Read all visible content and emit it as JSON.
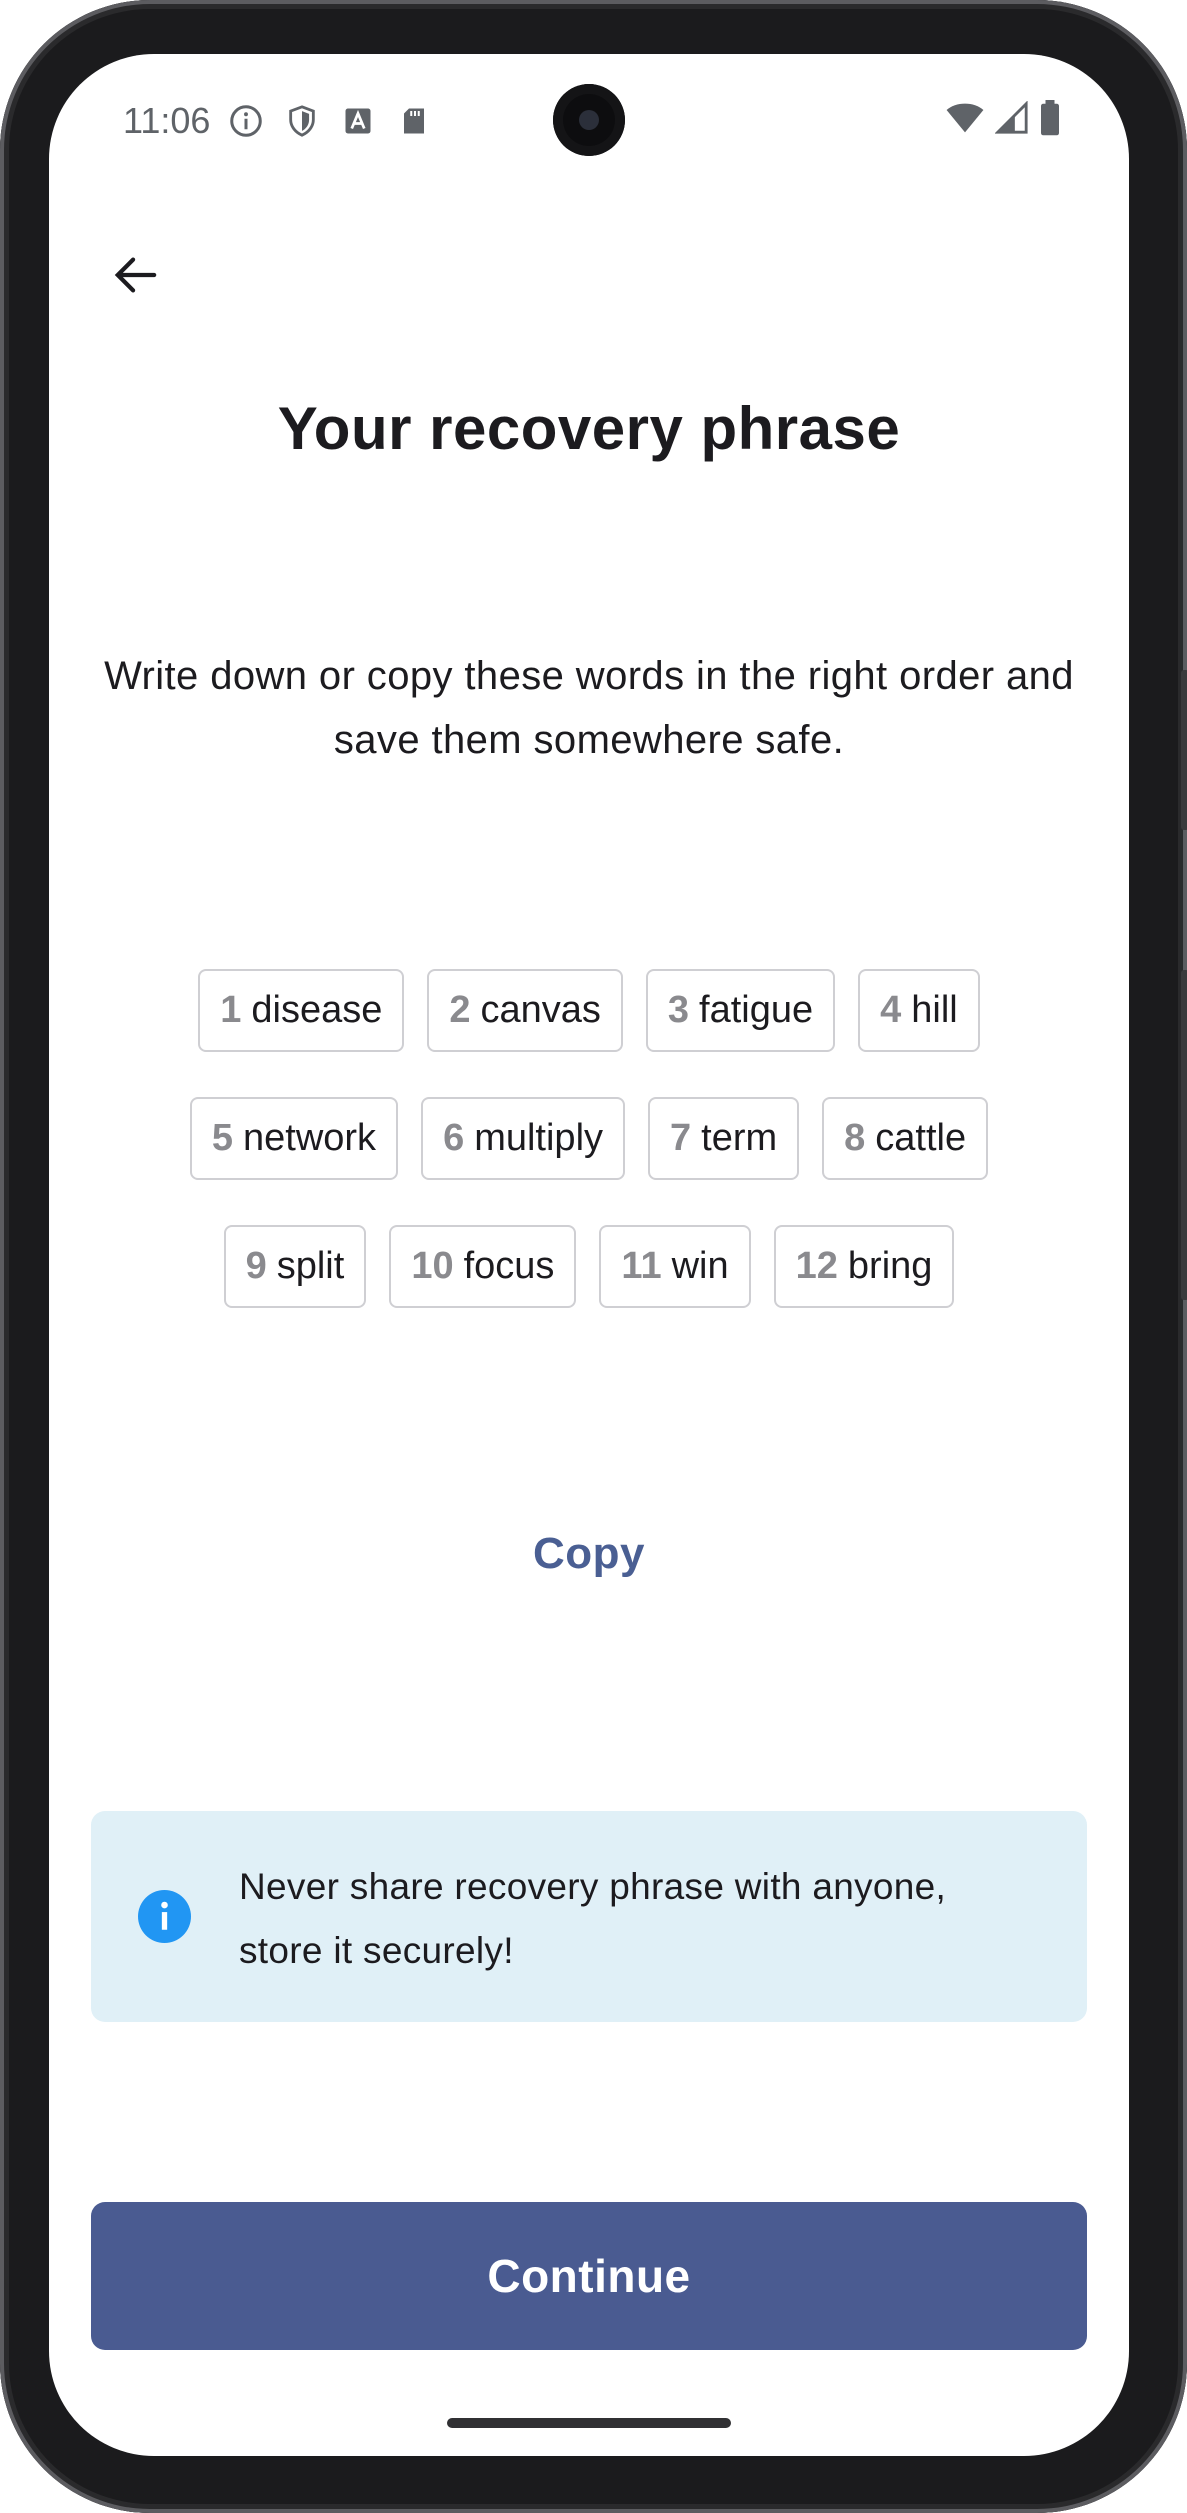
{
  "status_bar": {
    "time": "11:06",
    "left_icons": [
      "info-icon",
      "shield-icon",
      "text-a-icon",
      "sd-card-icon"
    ],
    "right_icons": [
      "wifi-icon",
      "signal-icon",
      "battery-icon"
    ]
  },
  "header": {
    "back_icon": "arrow-left-icon",
    "title": "Your recovery phrase"
  },
  "instructions": "Write down or copy these words in the right order and save them somewhere safe.",
  "phrase_rows": [
    [
      {
        "num": "1",
        "word": "disease"
      },
      {
        "num": "2",
        "word": "canvas"
      },
      {
        "num": "3",
        "word": "fatigue"
      },
      {
        "num": "4",
        "word": "hill"
      }
    ],
    [
      {
        "num": "5",
        "word": "network"
      },
      {
        "num": "6",
        "word": "multiply"
      },
      {
        "num": "7",
        "word": "term"
      },
      {
        "num": "8",
        "word": "cattle"
      }
    ],
    [
      {
        "num": "9",
        "word": "split"
      },
      {
        "num": "10",
        "word": "focus"
      },
      {
        "num": "11",
        "word": "win"
      },
      {
        "num": "12",
        "word": "bring"
      }
    ]
  ],
  "copy_label": "Copy",
  "notice": {
    "icon": "info-circle-icon",
    "text": "Never share recovery phrase with anyone, store it securely!",
    "background": "#e0f0f7",
    "icon_color": "#2196f3"
  },
  "continue_label": "Continue",
  "colors": {
    "primary": "#4a5b91",
    "link": "#4a5f93",
    "text": "#1c1b1f",
    "chip_border": "#cfcfd3"
  }
}
